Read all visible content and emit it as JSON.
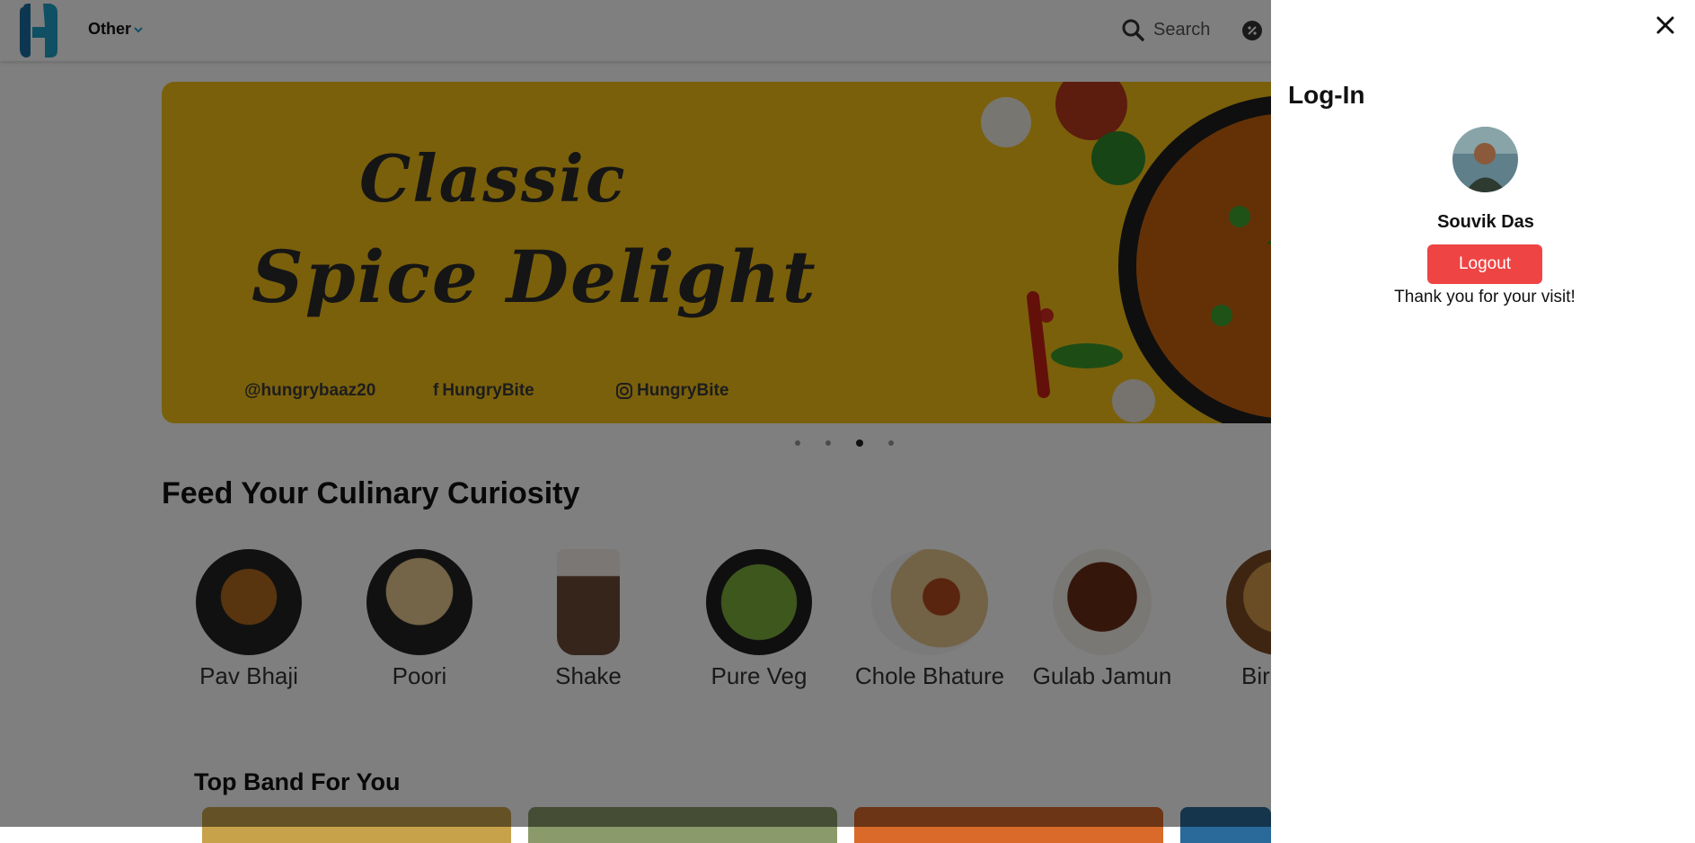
{
  "header": {
    "menu_label": "Other",
    "search_label": "Search"
  },
  "banner": {
    "title_line1": "Classic",
    "title_line2": "Spice Delight",
    "social_twitter": "@hungrybaaz20",
    "social_facebook": "HungryBite",
    "social_instagram": "HungryBite",
    "slide_count": 4,
    "active_slide": 3
  },
  "categories": {
    "title": "Feed Your Culinary Curiosity",
    "items": [
      {
        "label": "Pav Bhaji",
        "icon": "pav-bhaji-image"
      },
      {
        "label": "Poori",
        "icon": "poori-image"
      },
      {
        "label": "Shake",
        "icon": "shake-image"
      },
      {
        "label": "Pure Veg",
        "icon": "pure-veg-image"
      },
      {
        "label": "Chole Bhature",
        "icon": "chole-bhature-image"
      },
      {
        "label": "Gulab Jamun",
        "icon": "gulab-jamun-image"
      },
      {
        "label": "Bir",
        "icon": "biryani-image"
      }
    ]
  },
  "bands": {
    "title": "Top Band For You"
  },
  "login_panel": {
    "title": "Log-In",
    "user_name": "Souvik Das",
    "logout_label": "Logout",
    "message": "Thank you for your visit!"
  },
  "colors": {
    "accent": "#ef4444",
    "banner_bg": "#f5c116",
    "logo_blue": "#1ea1c8"
  }
}
